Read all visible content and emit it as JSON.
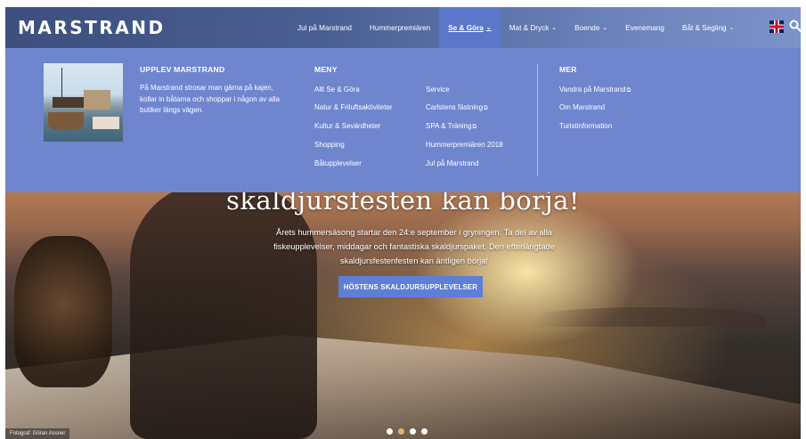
{
  "header": {
    "logo": "MARSTRAND",
    "nav": [
      {
        "label": "Jul på Marstrand",
        "chevron": false
      },
      {
        "label": "Hummerpremiären",
        "chevron": false
      },
      {
        "label": "Se & Göra",
        "chevron": true,
        "active": true
      },
      {
        "label": "Mat & Dryck",
        "chevron": true
      },
      {
        "label": "Boende",
        "chevron": true
      },
      {
        "label": "Evenemang",
        "chevron": false
      },
      {
        "label": "Båt & Segling",
        "chevron": true
      }
    ],
    "chevron_glyph": "⌄",
    "flag_icon": "uk-flag-icon",
    "search_icon": "search-icon"
  },
  "menu": {
    "intro": {
      "title": "UPPLEV MARSTRAND",
      "text": "På Marstrand strosar man gärna på kajen, kollar in båtarna och shoppar i någon av alla butiker längs vägen."
    },
    "meny": {
      "title": "MENY",
      "col1": [
        "Allt Se & Göra",
        "Natur & Friluftsaktiviteter",
        "Kultur & Sevärdheter",
        "Shopping",
        "Båtupplevelser"
      ],
      "col2": [
        "Service",
        "Carlstens fästning",
        "SPA & Träning",
        "Hummerpremiären 2018",
        "Jul på Marstrand"
      ]
    },
    "mer": {
      "title": "MER",
      "links": [
        "Vandra på Marstrand",
        "Om Marstrand",
        "Turistinformation"
      ]
    },
    "external_glyph": "⧉"
  },
  "hero": {
    "title": "skaldjursfesten kan börja!",
    "text": "Årets hummersäsong startar den 24:e september i gryningen. Ta del av alla fiskeupplevelser, middagar och fantastiska skaldjurspaket. Den efterlängtade skaldjursfestenfesten kan äntligen börja!",
    "cta": "HÖSTENS SKALDJURSUPPLEVELSER",
    "credit": "Fotograf: Göran Assner",
    "dots": 4,
    "active_dot": 1
  },
  "colors": {
    "menu_bg": "#6f86cf",
    "active_nav": "#5b77c9",
    "cta_bg": "#5e7fd6"
  }
}
